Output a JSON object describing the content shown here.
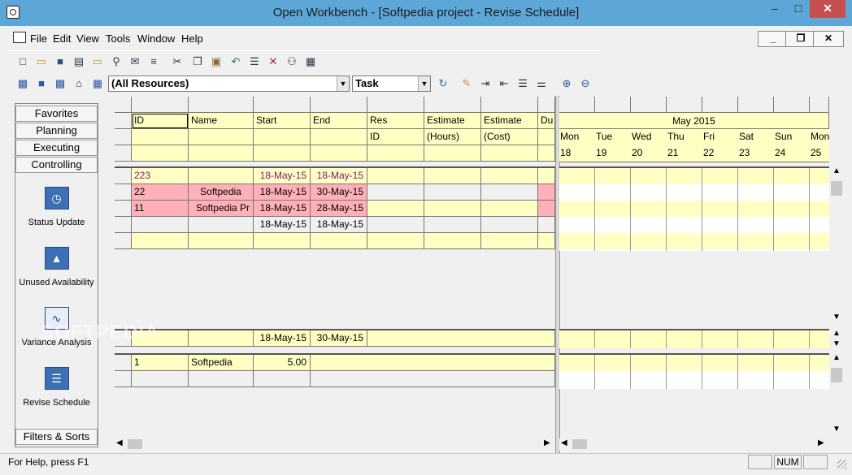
{
  "window": {
    "title": "Open Workbench - [Softpedia project - Revise Schedule]"
  },
  "menu": [
    "File",
    "Edit",
    "View",
    "Tools",
    "Window",
    "Help"
  ],
  "mdi": {
    "minimize": "_",
    "restore": "❐",
    "close": "✕"
  },
  "toolbar": {
    "resources_combo": "(All Resources)",
    "task_combo": "Task"
  },
  "sidebar": {
    "tabs": [
      "Favorites",
      "Planning",
      "Executing",
      "Controlling"
    ],
    "items": [
      {
        "label": "Status Update",
        "icon": "clock-icon"
      },
      {
        "label": "Unused Availability",
        "icon": "person-icon"
      },
      {
        "label": "Variance Analysis",
        "icon": "chart-icon"
      },
      {
        "label": "Revise Schedule",
        "icon": "gantt-icon"
      }
    ],
    "bottom_tab": "Filters & Sorts"
  },
  "columns": [
    {
      "h1": "ID",
      "h2": ""
    },
    {
      "h1": "Name",
      "h2": ""
    },
    {
      "h1": "Start",
      "h2": ""
    },
    {
      "h1": "End",
      "h2": ""
    },
    {
      "h1": "Res",
      "h2": "ID"
    },
    {
      "h1": "Estimate",
      "h2": "(Hours)"
    },
    {
      "h1": "Estimate",
      "h2": "(Cost)"
    },
    {
      "h1": "Du",
      "h2": ""
    }
  ],
  "rows": [
    {
      "id": "223",
      "name": "",
      "start": "18-May-15",
      "end": "18-May-15"
    },
    {
      "id": "22",
      "name": "Softpedia",
      "start": "18-May-15",
      "end": "30-May-15"
    },
    {
      "id": "11",
      "name": "Softpedia Pr",
      "start": "18-May-15",
      "end": "28-May-15"
    },
    {
      "id": "",
      "name": "",
      "start": "18-May-15",
      "end": "18-May-15"
    }
  ],
  "summary": {
    "start": "18-May-15",
    "end": "30-May-15"
  },
  "resource": {
    "id": "1",
    "name": "Softpedia",
    "value": "5.00"
  },
  "calendar": {
    "month": "May 2015",
    "days": [
      {
        "d": "Mon",
        "n": "18"
      },
      {
        "d": "Tue",
        "n": "19"
      },
      {
        "d": "Wed",
        "n": "20"
      },
      {
        "d": "Thu",
        "n": "21"
      },
      {
        "d": "Fri",
        "n": "22"
      },
      {
        "d": "Sat",
        "n": "23"
      },
      {
        "d": "Sun",
        "n": "24"
      },
      {
        "d": "Mon",
        "n": "25"
      }
    ]
  },
  "watermark": "SOFTPEDIA",
  "status": {
    "help": "For Help, press F1",
    "num": "NUM"
  }
}
